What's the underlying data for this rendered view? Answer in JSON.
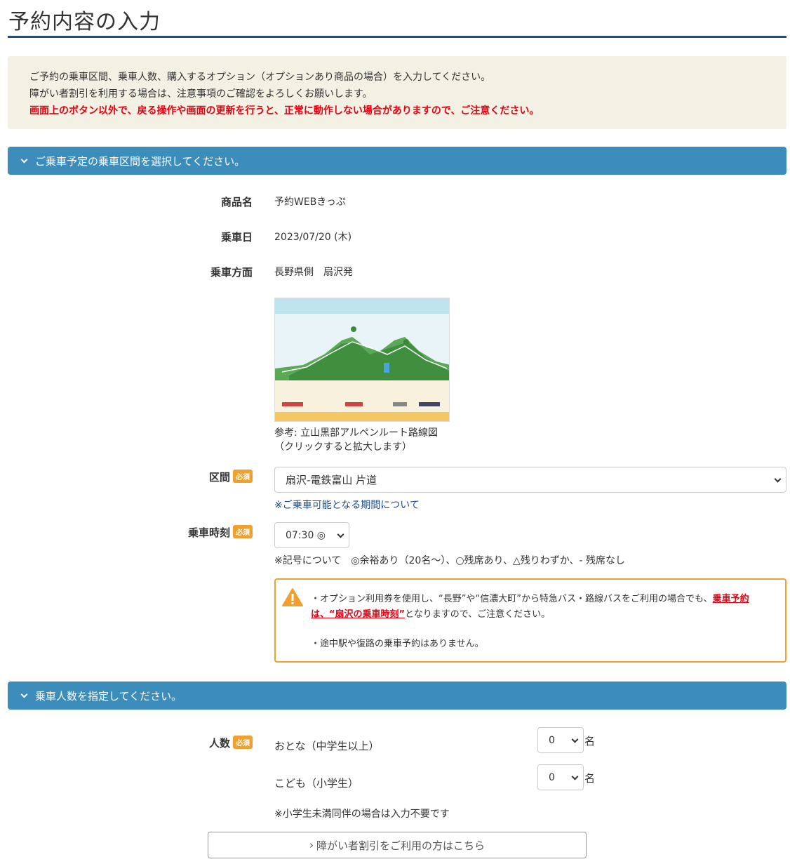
{
  "page": {
    "title": "予約内容の入力"
  },
  "notice": {
    "line1": "ご予約の乗車区間、乗車人数、購入するオプション（オプションあり商品の場合）を入力してください。",
    "line2": "障がい者割引を利用する場合は、注意事項のご確認をよろしくお願いします。",
    "warning": "画面上のボタン以外で、戻る操作や画面の更新を行うと、正常に動作しない場合がありますので、ご注意ください。"
  },
  "section1": {
    "title": "ご乗車予定の乗車区間を選択してください。",
    "product_label": "商品名",
    "product_value": "予約WEBきっぷ",
    "date_label": "乗車日",
    "date_value": "2023/07/20 (木)",
    "direction_label": "乗車方面",
    "direction_value": "長野県側　扇沢発",
    "map_caption_1": "参考: 立山黒部アルペンルート路線図",
    "map_caption_2": "（クリックすると拡大します）",
    "section_label": "区間",
    "section_value": "扇沢-電鉄富山 片道",
    "period_link": "※ご乗車可能となる期間について",
    "time_label": "乗車時刻",
    "time_value": "07:30 ◎",
    "legend": "※記号について　◎余裕あり（20名～）、○残席あり、△残りわずか、- 残席なし",
    "alert_line1_prefix": "・オプション利用券を使用し、“長野”や“信濃大町”から特急バス・路線バスをご利用の場合でも、",
    "alert_line1_red": "乗車予約は、“扇沢の乗車時刻”",
    "alert_line1_suffix": "となりますので、ご注意ください。",
    "alert_line2": "・途中駅や復路の乗車予約はありません。"
  },
  "required_badge": "必須",
  "section2": {
    "title": "乗車人数を指定してください。",
    "count_label": "人数",
    "adult_label": "おとな（中学生以上）",
    "adult_value": "0",
    "child_label": "こども（小学生）",
    "child_value": "0",
    "unit": "名",
    "note": "※小学生未満同伴の場合は入力不要です",
    "disability_button": "障がい者割引をご利用の方はこちら"
  },
  "colors": {
    "accent_bar": "#3c8dbc",
    "title_rule": "#1f4b8f",
    "warning_red": "#e60012",
    "badge_orange": "#f0a030",
    "notice_bg": "#f3f0e4"
  }
}
